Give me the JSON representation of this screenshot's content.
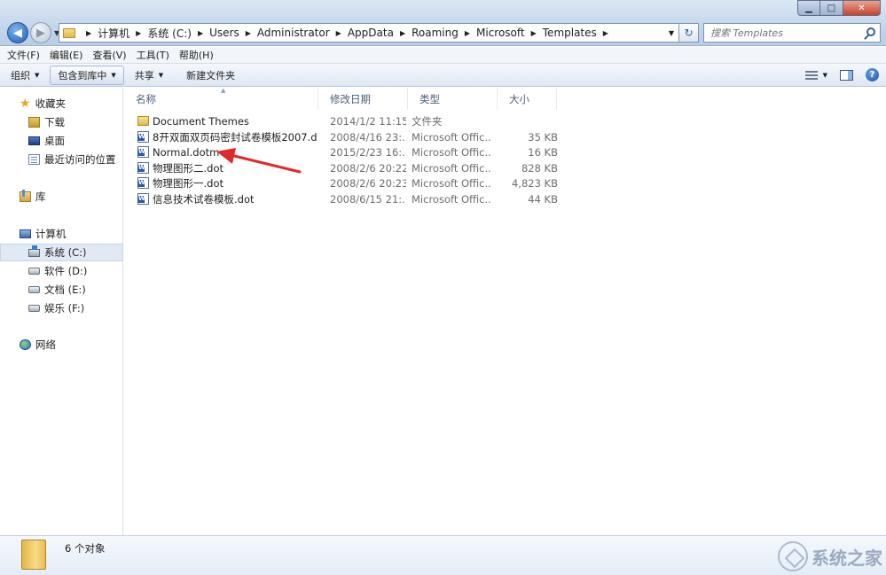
{
  "window": {
    "minimize_glyph": "▁",
    "maximize_glyph": "□",
    "close_glyph": "✕"
  },
  "address": {
    "crumbs": [
      "计算机",
      "系统 (C:)",
      "Users",
      "Administrator",
      "AppData",
      "Roaming",
      "Microsoft",
      "Templates"
    ],
    "refresh_glyph": "↻"
  },
  "search": {
    "placeholder": "搜索 Templates"
  },
  "menubar": {
    "items": [
      "文件(F)",
      "编辑(E)",
      "查看(V)",
      "工具(T)",
      "帮助(H)"
    ]
  },
  "commandbar": {
    "organize": "组织",
    "include_in_library": "包含到库中",
    "share": "共享",
    "new_folder": "新建文件夹",
    "help_glyph": "?"
  },
  "navpane": {
    "favorites": "收藏夹",
    "downloads": "下载",
    "desktop": "桌面",
    "recent": "最近访问的位置",
    "libraries": "库",
    "computer": "计算机",
    "drive_c": "系统 (C:)",
    "drive_d": "软件 (D:)",
    "drive_e": "文档 (E:)",
    "drive_f": "娱乐 (F:)",
    "network": "网络"
  },
  "filelist": {
    "columns": [
      "名称",
      "修改日期",
      "类型",
      "大小"
    ],
    "rows": [
      {
        "name": "Document Themes",
        "date": "2014/1/2 11:15",
        "type": "文件夹",
        "size": "",
        "icon": "folder-icon"
      },
      {
        "name": "8开双面双页码密封试卷模板2007.do...",
        "date": "2008/4/16 23:...",
        "type": "Microsoft Offic...",
        "size": "35 KB",
        "icon": "word-doc-icon"
      },
      {
        "name": "Normal.dotm",
        "date": "2015/2/23 16:...",
        "type": "Microsoft Offic...",
        "size": "16 KB",
        "icon": "word-doc-icon"
      },
      {
        "name": "物理图形二.dot",
        "date": "2008/2/6 20:22",
        "type": "Microsoft Offic...",
        "size": "828 KB",
        "icon": "word-doc-icon"
      },
      {
        "name": "物理图形一.dot",
        "date": "2008/2/6 20:23",
        "type": "Microsoft Offic...",
        "size": "4,823 KB",
        "icon": "word-doc-icon"
      },
      {
        "name": "信息技术试卷模板.dot",
        "date": "2008/6/15 21:...",
        "type": "Microsoft Offic...",
        "size": "44 KB",
        "icon": "word-doc-icon"
      }
    ]
  },
  "details": {
    "count_text": "6 个对象"
  },
  "watermark": {
    "text": "系统之家"
  },
  "colors": {
    "annotation_arrow": "#e02a2a",
    "selection_bg": "#e1e9f4",
    "titlebar": "#c4d6ec"
  }
}
